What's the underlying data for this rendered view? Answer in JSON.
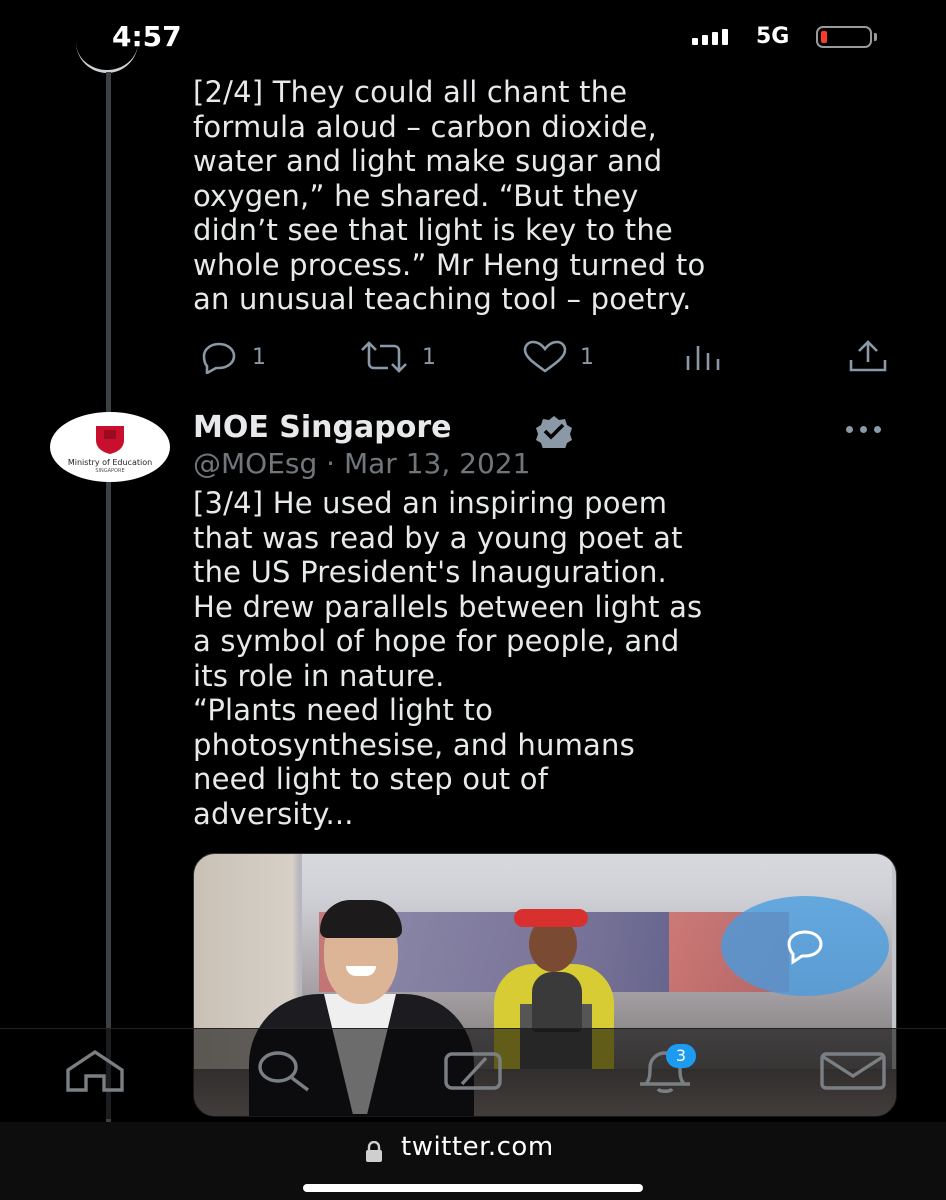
{
  "status_bar": {
    "time": "4:57",
    "network": "5G"
  },
  "tweet_prev": {
    "text": "[2/4] They could all chant the\nformula aloud – carbon dioxide,\nwater and light make sugar and\noxygen,” he shared. “But they\ndidn’t see that light is key to the\nwhole process.” Mr Heng turned to\nan unusual teaching tool – poetry.",
    "replies": "1",
    "retweets": "1",
    "likes": "1"
  },
  "tweet_main": {
    "author_name": "MOE Singapore",
    "handle": "@MOEsg",
    "separator": "·",
    "date": "Mar 13, 2021",
    "avatar_text": "Ministry of Education",
    "avatar_subtext": "SINGAPORE",
    "text": "[3/4] He used an inspiring poem\nthat was read by a young poet at\nthe US President's Inauguration.\nHe drew parallels between light as\na symbol of hope for people, and\nits role in nature.\n“Plants need light to\nphotosynthesise, and humans\nneed light to step out of\nadversity..."
  },
  "bottom_nav": {
    "items": [
      "home-icon",
      "search-icon",
      "communities-icon",
      "notifications-icon",
      "messages-icon"
    ],
    "notification_count": "3"
  },
  "url_bar": {
    "url": "twitter.com"
  },
  "colors": {
    "accent": "#1d9bf0",
    "muted": "#71767b",
    "background": "#000000"
  }
}
